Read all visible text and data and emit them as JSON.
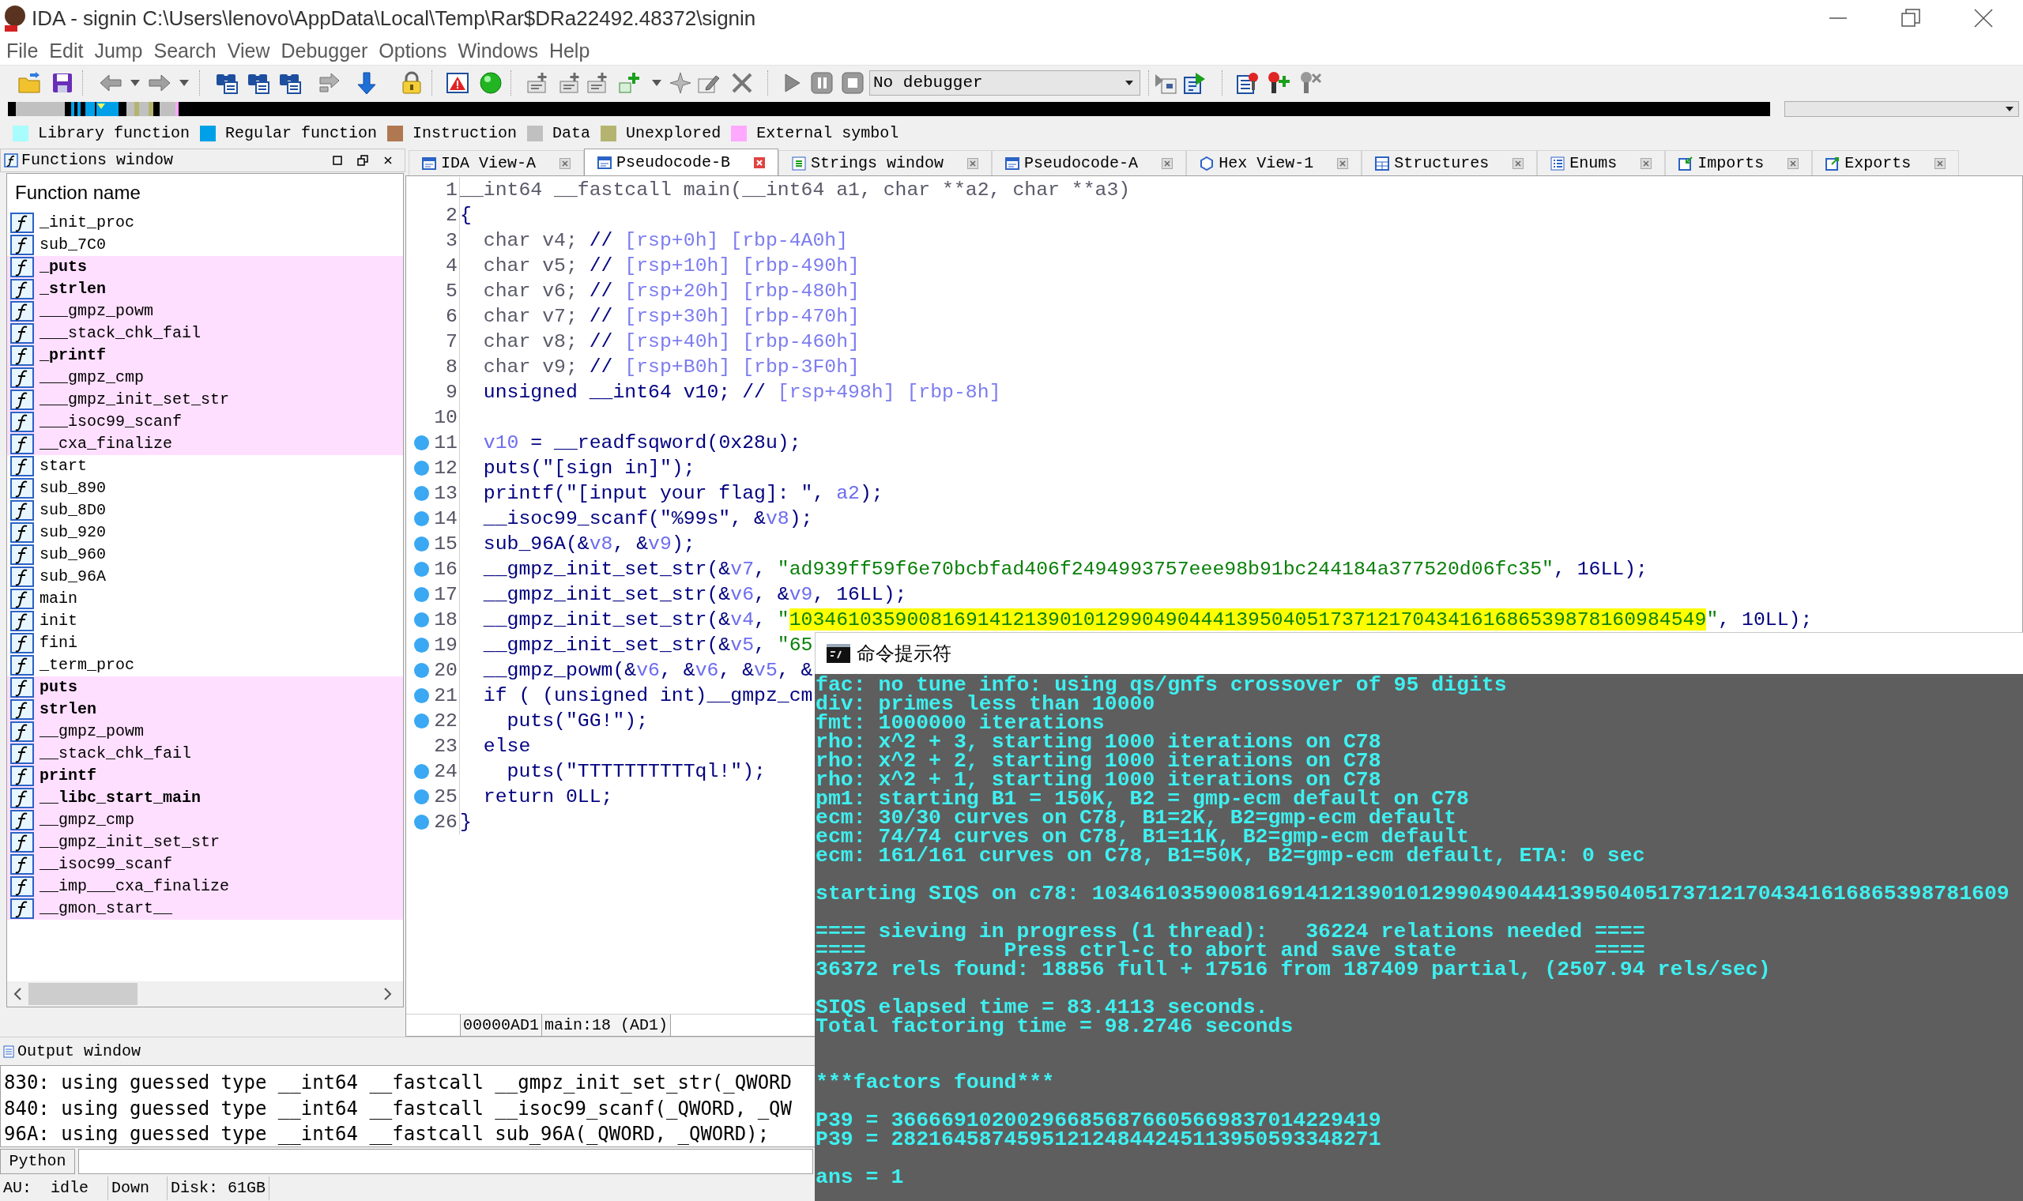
{
  "window": {
    "title": "IDA - signin C:\\Users\\lenovo\\AppData\\Local\\Temp\\Rar$DRa22492.48372\\signin"
  },
  "menu": [
    "File",
    "Edit",
    "Jump",
    "Search",
    "View",
    "Debugger",
    "Options",
    "Windows",
    "Help"
  ],
  "toolbar": {
    "debugger_select": "No debugger"
  },
  "legend": [
    {
      "label": "Library function",
      "color": "#a8fcfc"
    },
    {
      "label": "Regular function",
      "color": "#00a0e8"
    },
    {
      "label": "Instruction",
      "color": "#b07850"
    },
    {
      "label": "Data",
      "color": "#c0c0c0"
    },
    {
      "label": "Unexplored",
      "color": "#b4b470"
    },
    {
      "label": "External symbol",
      "color": "#ffa8ff"
    }
  ],
  "functions_window": {
    "title": "Functions window",
    "column": "Function name",
    "items": [
      {
        "name": "_init_proc",
        "bold": false,
        "highlighted": false
      },
      {
        "name": "sub_7C0",
        "bold": false,
        "highlighted": false
      },
      {
        "name": "_puts",
        "bold": true,
        "highlighted": true
      },
      {
        "name": "_strlen",
        "bold": true,
        "highlighted": true
      },
      {
        "name": "___gmpz_powm",
        "bold": false,
        "highlighted": true
      },
      {
        "name": "___stack_chk_fail",
        "bold": false,
        "highlighted": true
      },
      {
        "name": "_printf",
        "bold": true,
        "highlighted": true
      },
      {
        "name": "___gmpz_cmp",
        "bold": false,
        "highlighted": true
      },
      {
        "name": "___gmpz_init_set_str",
        "bold": false,
        "highlighted": true
      },
      {
        "name": "___isoc99_scanf",
        "bold": false,
        "highlighted": true
      },
      {
        "name": "__cxa_finalize",
        "bold": false,
        "highlighted": true
      },
      {
        "name": "start",
        "bold": false,
        "highlighted": false
      },
      {
        "name": "sub_890",
        "bold": false,
        "highlighted": false
      },
      {
        "name": "sub_8D0",
        "bold": false,
        "highlighted": false
      },
      {
        "name": "sub_920",
        "bold": false,
        "highlighted": false
      },
      {
        "name": "sub_960",
        "bold": false,
        "highlighted": false
      },
      {
        "name": "sub_96A",
        "bold": false,
        "highlighted": false
      },
      {
        "name": "main",
        "bold": false,
        "highlighted": false
      },
      {
        "name": "init",
        "bold": false,
        "highlighted": false
      },
      {
        "name": "fini",
        "bold": false,
        "highlighted": false
      },
      {
        "name": "_term_proc",
        "bold": false,
        "highlighted": false
      },
      {
        "name": "puts",
        "bold": true,
        "highlighted": true
      },
      {
        "name": "strlen",
        "bold": true,
        "highlighted": true
      },
      {
        "name": "__gmpz_powm",
        "bold": false,
        "highlighted": true
      },
      {
        "name": "__stack_chk_fail",
        "bold": false,
        "highlighted": true
      },
      {
        "name": "printf",
        "bold": true,
        "highlighted": true
      },
      {
        "name": "__libc_start_main",
        "bold": true,
        "highlighted": true
      },
      {
        "name": "__gmpz_cmp",
        "bold": false,
        "highlighted": true
      },
      {
        "name": "__gmpz_init_set_str",
        "bold": false,
        "highlighted": true
      },
      {
        "name": "__isoc99_scanf",
        "bold": false,
        "highlighted": true
      },
      {
        "name": "__imp___cxa_finalize",
        "bold": false,
        "highlighted": true
      },
      {
        "name": "__gmon_start__",
        "bold": false,
        "highlighted": true
      }
    ]
  },
  "tabs": [
    {
      "label": "IDA View-A",
      "kind": "disassembly",
      "selected": false
    },
    {
      "label": "Pseudocode-B",
      "kind": "pseudocode",
      "selected": true
    },
    {
      "label": "Strings window",
      "kind": "strings",
      "selected": false
    },
    {
      "label": "Pseudocode-A",
      "kind": "pseudocode",
      "selected": false
    },
    {
      "label": "Hex View-1",
      "kind": "hex",
      "selected": false
    },
    {
      "label": "Structures",
      "kind": "structures",
      "selected": false
    },
    {
      "label": "Enums",
      "kind": "enums",
      "selected": false
    },
    {
      "label": "Imports",
      "kind": "imports",
      "selected": false
    },
    {
      "label": "Exports",
      "kind": "exports",
      "selected": false
    }
  ],
  "pseudocode": {
    "lines": [
      {
        "number": "1",
        "dot": false,
        "segments": [
          {
            "kind": "dim",
            "text": "__int64 __fastcall main(__int64 a1, char **a2, char **a3)"
          }
        ]
      },
      {
        "number": "2",
        "dot": false,
        "segments": [
          {
            "kind": "text",
            "text": "{"
          }
        ]
      },
      {
        "number": "3",
        "dot": false,
        "segments": [
          {
            "kind": "dim",
            "text": "  char v4; "
          },
          {
            "kind": "text",
            "text": "// "
          },
          {
            "kind": "comment",
            "text": "[rsp+0h] [rbp-4A0h]"
          }
        ]
      },
      {
        "number": "4",
        "dot": false,
        "segments": [
          {
            "kind": "dim",
            "text": "  char v5; "
          },
          {
            "kind": "text",
            "text": "// "
          },
          {
            "kind": "comment",
            "text": "[rsp+10h] [rbp-490h]"
          }
        ]
      },
      {
        "number": "5",
        "dot": false,
        "segments": [
          {
            "kind": "dim",
            "text": "  char v6; "
          },
          {
            "kind": "text",
            "text": "// "
          },
          {
            "kind": "comment",
            "text": "[rsp+20h] [rbp-480h]"
          }
        ]
      },
      {
        "number": "6",
        "dot": false,
        "segments": [
          {
            "kind": "dim",
            "text": "  char v7; "
          },
          {
            "kind": "text",
            "text": "// "
          },
          {
            "kind": "comment",
            "text": "[rsp+30h] [rbp-470h]"
          }
        ]
      },
      {
        "number": "7",
        "dot": false,
        "segments": [
          {
            "kind": "dim",
            "text": "  char v8; "
          },
          {
            "kind": "text",
            "text": "// "
          },
          {
            "kind": "comment",
            "text": "[rsp+40h] [rbp-460h]"
          }
        ]
      },
      {
        "number": "8",
        "dot": false,
        "segments": [
          {
            "kind": "dim",
            "text": "  char v9; "
          },
          {
            "kind": "text",
            "text": "// "
          },
          {
            "kind": "comment",
            "text": "[rsp+B0h] [rbp-3F0h]"
          }
        ]
      },
      {
        "number": "9",
        "dot": false,
        "segments": [
          {
            "kind": "text",
            "text": "  unsigned __int64 v10; // "
          },
          {
            "kind": "comment",
            "text": "[rsp+498h] [rbp-8h]"
          }
        ]
      },
      {
        "number": "10",
        "dot": false
      },
      {
        "number": "11",
        "dot": true,
        "segments": [
          {
            "kind": "var",
            "text": "  v10"
          },
          {
            "kind": "text",
            "text": " = __readfsqword(0x28u);"
          }
        ]
      },
      {
        "number": "12",
        "dot": true,
        "segments": [
          {
            "kind": "text",
            "text": "  puts(\"[sign in]\");"
          }
        ]
      },
      {
        "number": "13",
        "dot": true,
        "segments": [
          {
            "kind": "text",
            "text": "  printf(\"[input your flag]: \", "
          },
          {
            "kind": "var",
            "text": "a2"
          },
          {
            "kind": "text",
            "text": ");"
          }
        ]
      },
      {
        "number": "14",
        "dot": true,
        "segments": [
          {
            "kind": "text",
            "text": "  __isoc99_scanf(\"%99s\", &"
          },
          {
            "kind": "var",
            "text": "v8"
          },
          {
            "kind": "text",
            "text": ");"
          }
        ]
      },
      {
        "number": "15",
        "dot": true,
        "segments": [
          {
            "kind": "text",
            "text": "  sub_96A(&"
          },
          {
            "kind": "var",
            "text": "v8"
          },
          {
            "kind": "text",
            "text": ", &"
          },
          {
            "kind": "var",
            "text": "v9"
          },
          {
            "kind": "text",
            "text": ");"
          }
        ]
      },
      {
        "number": "16",
        "dot": true,
        "segments": [
          {
            "kind": "text",
            "text": "  __gmpz_init_set_str(&"
          },
          {
            "kind": "var",
            "text": "v7"
          },
          {
            "kind": "text",
            "text": ", "
          },
          {
            "kind": "string",
            "text": "\"ad939ff59f6e70bcbfad406f2494993757eee98b91bc244184a377520d06fc35\""
          },
          {
            "kind": "text",
            "text": ", 16LL);"
          }
        ]
      },
      {
        "number": "17",
        "dot": true,
        "segments": [
          {
            "kind": "text",
            "text": "  __gmpz_init_set_str(&"
          },
          {
            "kind": "var",
            "text": "v6"
          },
          {
            "kind": "text",
            "text": ", &"
          },
          {
            "kind": "var",
            "text": "v9"
          },
          {
            "kind": "text",
            "text": ", 16LL);"
          }
        ]
      },
      {
        "number": "18",
        "dot": true,
        "segments": [
          {
            "kind": "text",
            "text": "  __gmpz_init_set_str(&"
          },
          {
            "kind": "var",
            "text": "v4"
          },
          {
            "kind": "text",
            "text": ", "
          },
          {
            "kind": "string",
            "text": "\""
          },
          {
            "kind": "selected",
            "text": "103461035900816914121390101299049044413950405173712170434161686539878160984549"
          },
          {
            "kind": "string",
            "text": "\""
          },
          {
            "kind": "text",
            "text": ", 10LL);"
          }
        ]
      },
      {
        "number": "19",
        "dot": true,
        "segments": [
          {
            "kind": "text",
            "text": "  __gmpz_init_set_str(&"
          },
          {
            "kind": "var",
            "text": "v5"
          },
          {
            "kind": "text",
            "text": ", "
          },
          {
            "kind": "string",
            "text": "\"65"
          }
        ]
      },
      {
        "number": "20",
        "dot": true,
        "segments": [
          {
            "kind": "text",
            "text": "  __gmpz_powm(&"
          },
          {
            "kind": "var",
            "text": "v6"
          },
          {
            "kind": "text",
            "text": ", &"
          },
          {
            "kind": "var",
            "text": "v6"
          },
          {
            "kind": "text",
            "text": ", &"
          },
          {
            "kind": "var",
            "text": "v5"
          },
          {
            "kind": "text",
            "text": ", &"
          }
        ]
      },
      {
        "number": "21",
        "dot": true,
        "segments": [
          {
            "kind": "text",
            "text": "  if ( (unsigned int)__gmpz_cm"
          }
        ]
      },
      {
        "number": "22",
        "dot": true,
        "segments": [
          {
            "kind": "text",
            "text": "    puts(\"GG!\");"
          }
        ]
      },
      {
        "number": "23",
        "dot": false,
        "segments": [
          {
            "kind": "text",
            "text": "  else"
          }
        ]
      },
      {
        "number": "24",
        "dot": true,
        "segments": [
          {
            "kind": "text",
            "text": "    puts(\"TTTTTTTTTTql!\");"
          }
        ]
      },
      {
        "number": "25",
        "dot": true,
        "segments": [
          {
            "kind": "text",
            "text": "  return 0LL;"
          }
        ]
      },
      {
        "number": "26",
        "dot": true,
        "segments": [
          {
            "kind": "text",
            "text": "}"
          }
        ]
      }
    ],
    "status": [
      "00000AD1",
      "main:18 (AD1)"
    ]
  },
  "output_window": {
    "title": "Output window",
    "lines": [
      "830: using guessed type __int64 __fastcall __gmpz_init_set_str(_QWORD",
      "840: using guessed type __int64 __fastcall __isoc99_scanf(_QWORD, _QW",
      "96A: using guessed type __int64 __fastcall sub_96A(_QWORD, _QWORD);"
    ],
    "input_button": "Python"
  },
  "status_bar": [
    "AU:  idle",
    "Down",
    "Disk: 61GB"
  ],
  "console": {
    "title": "命令提示符",
    "log_blocks": [
      [
        "fac: no tune info: using qs/gnfs crossover of 95 digits",
        "div: primes less than 10000",
        "fmt: 1000000 iterations",
        "rho: x^2 + 3, starting 1000 iterations on C78",
        "rho: x^2 + 2, starting 1000 iterations on C78",
        "rho: x^2 + 1, starting 1000 iterations on C78",
        "pm1: starting B1 = 150K, B2 = gmp-ecm default on C78",
        "ecm: 30/30 curves on C78, B1=2K, B2=gmp-ecm default",
        "ecm: 74/74 curves on C78, B1=11K, B2=gmp-ecm default",
        "ecm: 161/161 curves on C78, B1=50K, B2=gmp-ecm default, ETA: 0 sec"
      ],
      [
        "starting SIQS on c78: 1034610359008169141213901012990490444139504051737121704341616865398781609"
      ],
      [
        "==== sieving in progress (1 thread):   36224 relations needed ====",
        "====           Press ctrl-c to abort and save state           ====",
        "36372 rels found: 18856 full + 17516 from 187409 partial, (2507.94 rels/sec)"
      ],
      [
        "SIQS elapsed time = 83.4113 seconds.",
        "Total factoring time = 98.2746 seconds"
      ]
    ],
    "result_blocks": [
      [
        "***factors found***"
      ],
      [
        "P39 = 366669102002966856876605669837014229419",
        "P39 = 282164587459512124844245113950593348271"
      ],
      [
        "ans = 1"
      ]
    ]
  }
}
